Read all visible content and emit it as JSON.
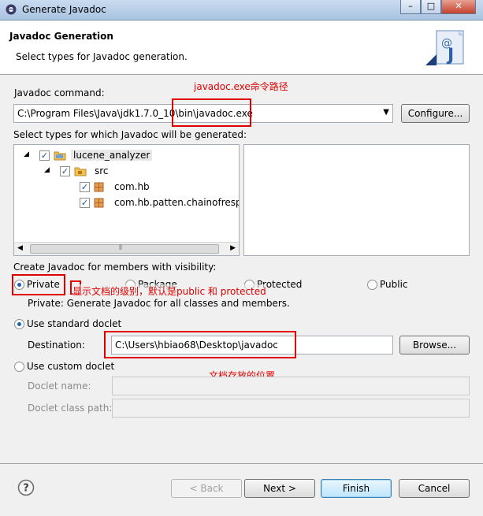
{
  "window": {
    "title": "Generate Javadoc"
  },
  "header": {
    "title": "Javadoc Generation",
    "subtitle": "Select types for Javadoc generation."
  },
  "javadoc_command": {
    "label": "Javadoc command:",
    "value": "C:\\Program Files\\Java\\jdk1.7.0_10\\bin\\javadoc.exe",
    "configure_label": "Configure...",
    "annotation": "javadoc.exe命令路径"
  },
  "types": {
    "label": "Select types for which Javadoc will be generated:",
    "tree": [
      {
        "label": "lucene_analyzer",
        "checked": true,
        "level": 0
      },
      {
        "label": "src",
        "checked": true,
        "level": 1
      },
      {
        "label": "com.hb",
        "checked": true,
        "level": 2
      },
      {
        "label": "com.hb.patten.chainofrespo",
        "checked": true,
        "level": 2
      }
    ]
  },
  "visibility": {
    "label": "Create Javadoc for members with visibility:",
    "options": [
      "Private",
      "Package",
      "Protected",
      "Public"
    ],
    "selected": "Private",
    "description": "Private: Generate Javadoc for all classes and members.",
    "annotation": "显示文档的级别，默认是public 和 protected"
  },
  "doclet": {
    "standard_label": "Use standard doclet",
    "destination_label": "Destination:",
    "destination_value": "C:\\Users\\hbiao68\\Desktop\\javadoc",
    "browse_label": "Browse...",
    "annotation": "文档存放的位置",
    "custom_label": "Use custom doclet",
    "doclet_name_label": "Doclet name:",
    "doclet_class_path_label": "Doclet class path:"
  },
  "footer": {
    "help_icon": "help-icon",
    "back_label": "< Back",
    "next_label": "Next >",
    "finish_label": "Finish",
    "cancel_label": "Cancel"
  }
}
